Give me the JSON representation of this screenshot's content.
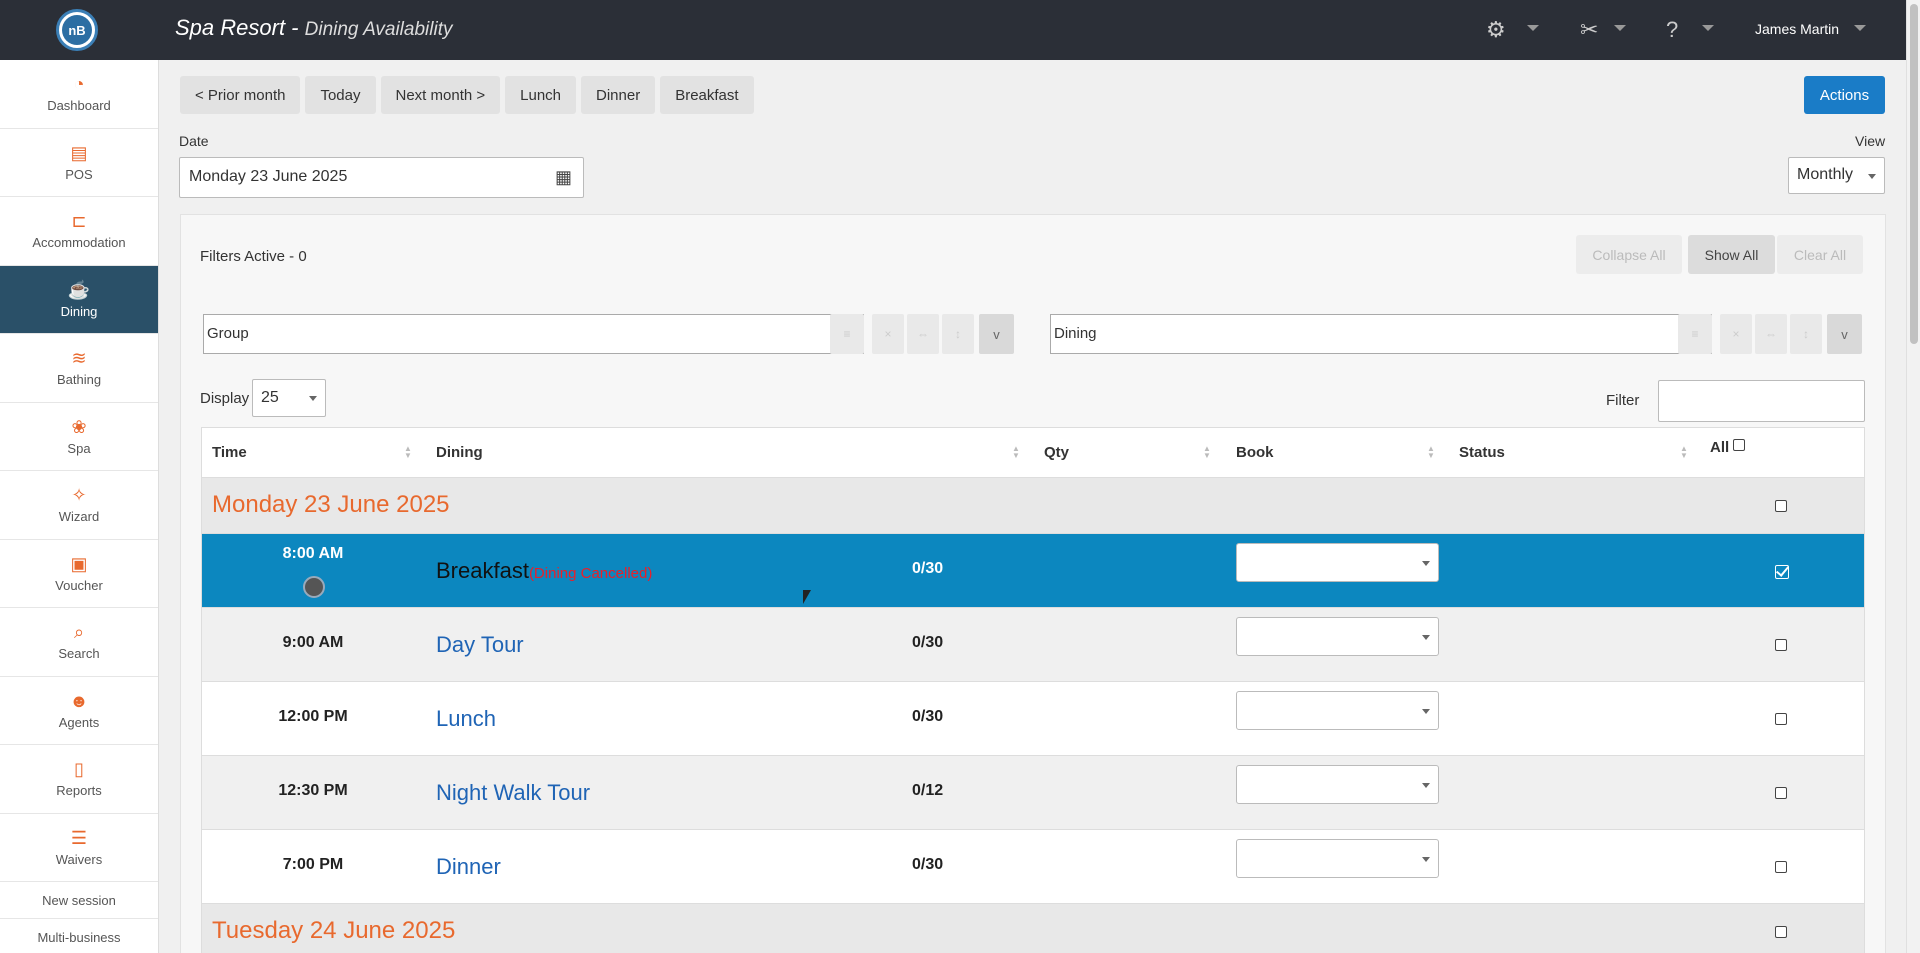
{
  "app": {
    "logo_text": "nB",
    "title": "Spa Resort",
    "title_separator": " - ",
    "subtitle": "Dining Availability",
    "user": "James Martin"
  },
  "topbar_icons": [
    "settings-gears-icon",
    "tools-icon",
    "help-icon"
  ],
  "sidebar": {
    "items": [
      {
        "label": "Dashboard",
        "icon": "speedometer-icon",
        "glyph": "◔",
        "active": false
      },
      {
        "label": "POS",
        "icon": "cash-register-icon",
        "glyph": "▤",
        "active": false
      },
      {
        "label": "Accommodation",
        "icon": "bed-icon",
        "glyph": "⊏",
        "active": false
      },
      {
        "label": "Dining",
        "icon": "dining-icon",
        "glyph": "☕",
        "active": true
      },
      {
        "label": "Bathing",
        "icon": "waves-icon",
        "glyph": "≋",
        "active": false
      },
      {
        "label": "Spa",
        "icon": "lotus-icon",
        "glyph": "❀",
        "active": false
      },
      {
        "label": "Wizard",
        "icon": "magic-wand-icon",
        "glyph": "✧",
        "active": false
      },
      {
        "label": "Voucher",
        "icon": "gift-icon",
        "glyph": "▣",
        "active": false
      },
      {
        "label": "Search",
        "icon": "search-icon",
        "glyph": "⌕",
        "active": false
      },
      {
        "label": "Agents",
        "icon": "people-icon",
        "glyph": "☻",
        "active": false
      },
      {
        "label": "Reports",
        "icon": "report-icon",
        "glyph": "▯",
        "active": false
      },
      {
        "label": "Waivers",
        "icon": "checklist-icon",
        "glyph": "☰",
        "active": false
      }
    ],
    "links": [
      "New session",
      "Multi-business"
    ]
  },
  "toolbar": {
    "buttons": [
      "< Prior month",
      "Today",
      "Next month >",
      "Lunch",
      "Dinner",
      "Breakfast"
    ],
    "actions_label": "Actions"
  },
  "date": {
    "label": "Date",
    "value": "Monday 23 June 2025"
  },
  "view": {
    "label": "View",
    "value": "Monthly"
  },
  "filters": {
    "active_text": "Filters Active - 0",
    "collapse_all": "Collapse All",
    "show_all": "Show All",
    "clear_all": "Clear All",
    "group_value": "Group",
    "dining_value": "Dining",
    "mini_symbols": [
      "≡",
      "×",
      "⇔",
      "↕",
      "v"
    ]
  },
  "display": {
    "label": "Display",
    "value": "25"
  },
  "filter_box": {
    "label": "Filter",
    "value": ""
  },
  "table": {
    "headers": {
      "time": "Time",
      "dining": "Dining",
      "qty": "Qty",
      "book": "Book",
      "status": "Status",
      "all": "All"
    },
    "groups": [
      {
        "title": "Monday 23 June 2025",
        "rows": [
          {
            "time": "8:00 AM",
            "name": "Breakfast",
            "note": "(Dining Cancelled)",
            "qty": "0/30",
            "selected": true
          },
          {
            "time": "9:00 AM",
            "name": "Day Tour",
            "note": "",
            "qty": "0/30",
            "selected": false
          },
          {
            "time": "12:00 PM",
            "name": "Lunch",
            "note": "",
            "qty": "0/30",
            "selected": false
          },
          {
            "time": "12:30 PM",
            "name": "Night Walk Tour",
            "note": "",
            "qty": "0/12",
            "selected": false
          },
          {
            "time": "7:00 PM",
            "name": "Dinner",
            "note": "",
            "qty": "0/30",
            "selected": false
          }
        ]
      },
      {
        "title": "Tuesday 24 June 2025",
        "rows": []
      }
    ]
  },
  "colors": {
    "accent": "#e8692e",
    "topbar": "#2b2f37",
    "sidebar_active": "#2a5068",
    "selected_row": "#0c87bf",
    "primary_button": "#1a7cc7",
    "link": "#1f64b5",
    "cancel_note": "#e8202a"
  }
}
